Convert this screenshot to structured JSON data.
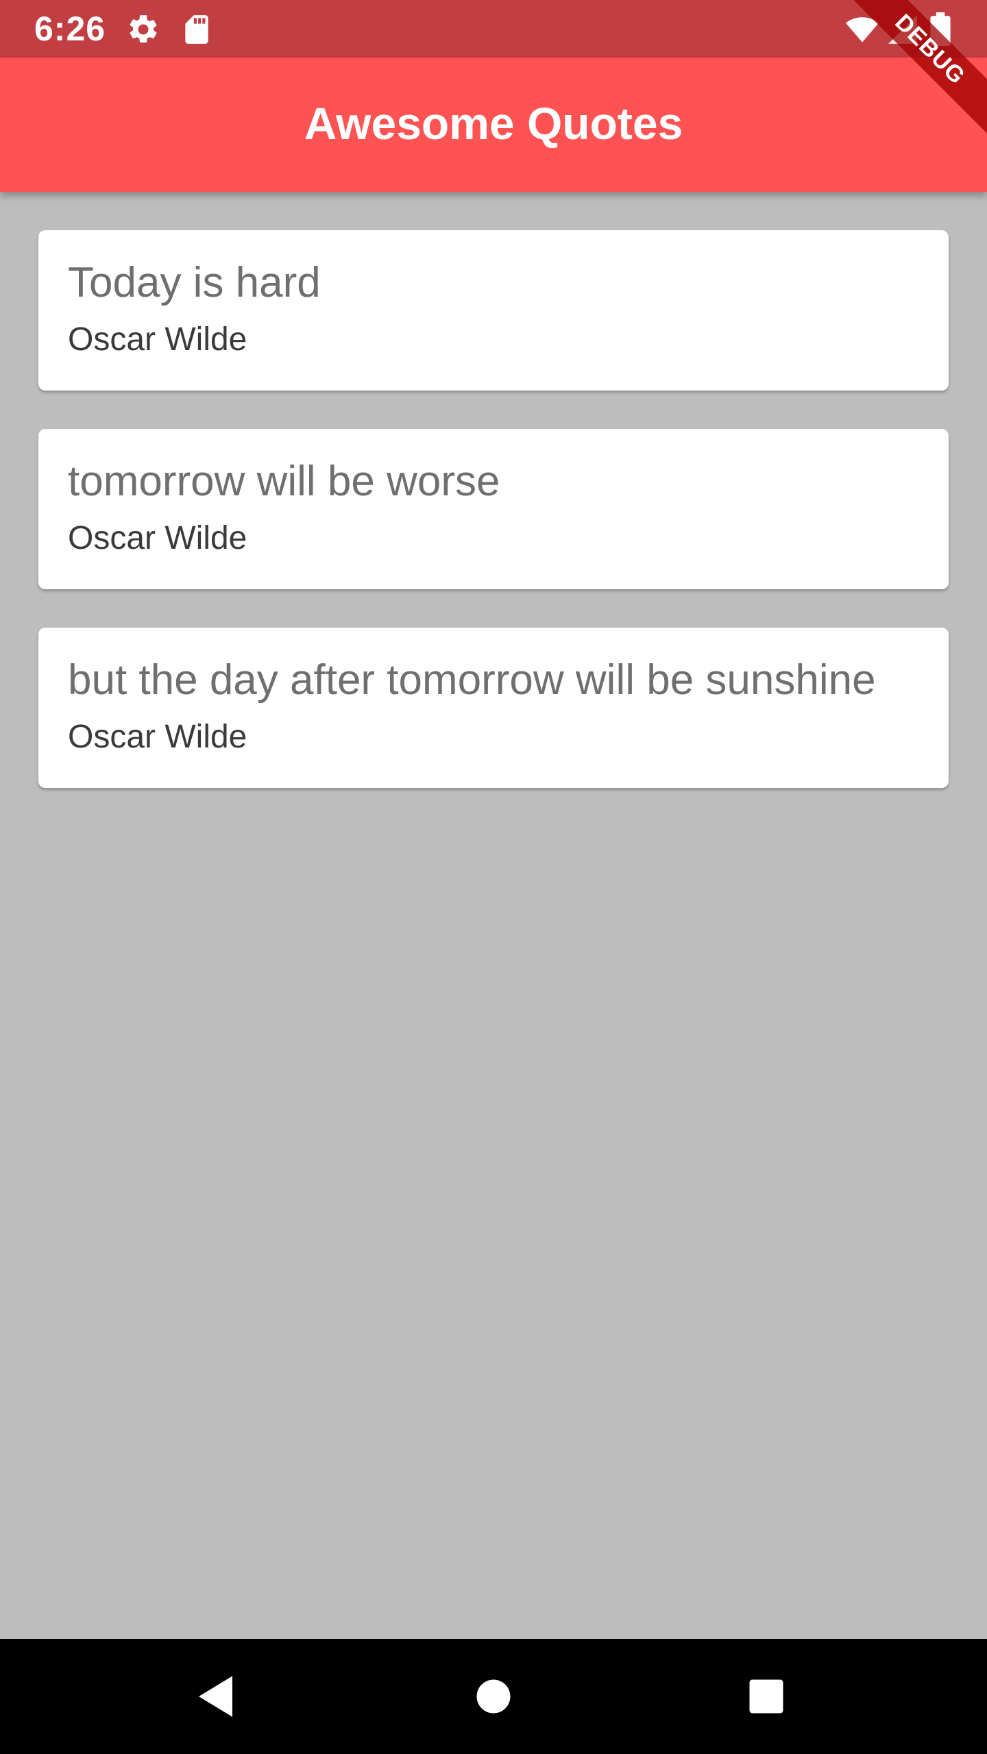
{
  "status_bar": {
    "time": "6:26",
    "icons": [
      "settings-icon",
      "sd-card-icon",
      "wifi-icon",
      "cell-signal-icon",
      "battery-icon"
    ]
  },
  "app_bar": {
    "title": "Awesome Quotes"
  },
  "debug_banner": {
    "label": "DEBUG"
  },
  "quotes": [
    {
      "text": "Today is hard",
      "author": "Oscar Wilde"
    },
    {
      "text": "tomorrow will be worse",
      "author": "Oscar Wilde"
    },
    {
      "text": "but the day after tomorrow will be sunshine",
      "author": "Oscar Wilde"
    }
  ],
  "nav_bar": {
    "icons": [
      "back-icon",
      "home-icon",
      "recents-icon"
    ]
  },
  "colors": {
    "status_bar": "#c13e42",
    "app_bar": "#ff5252",
    "background": "#bdbdbd",
    "card": "#ffffff"
  }
}
